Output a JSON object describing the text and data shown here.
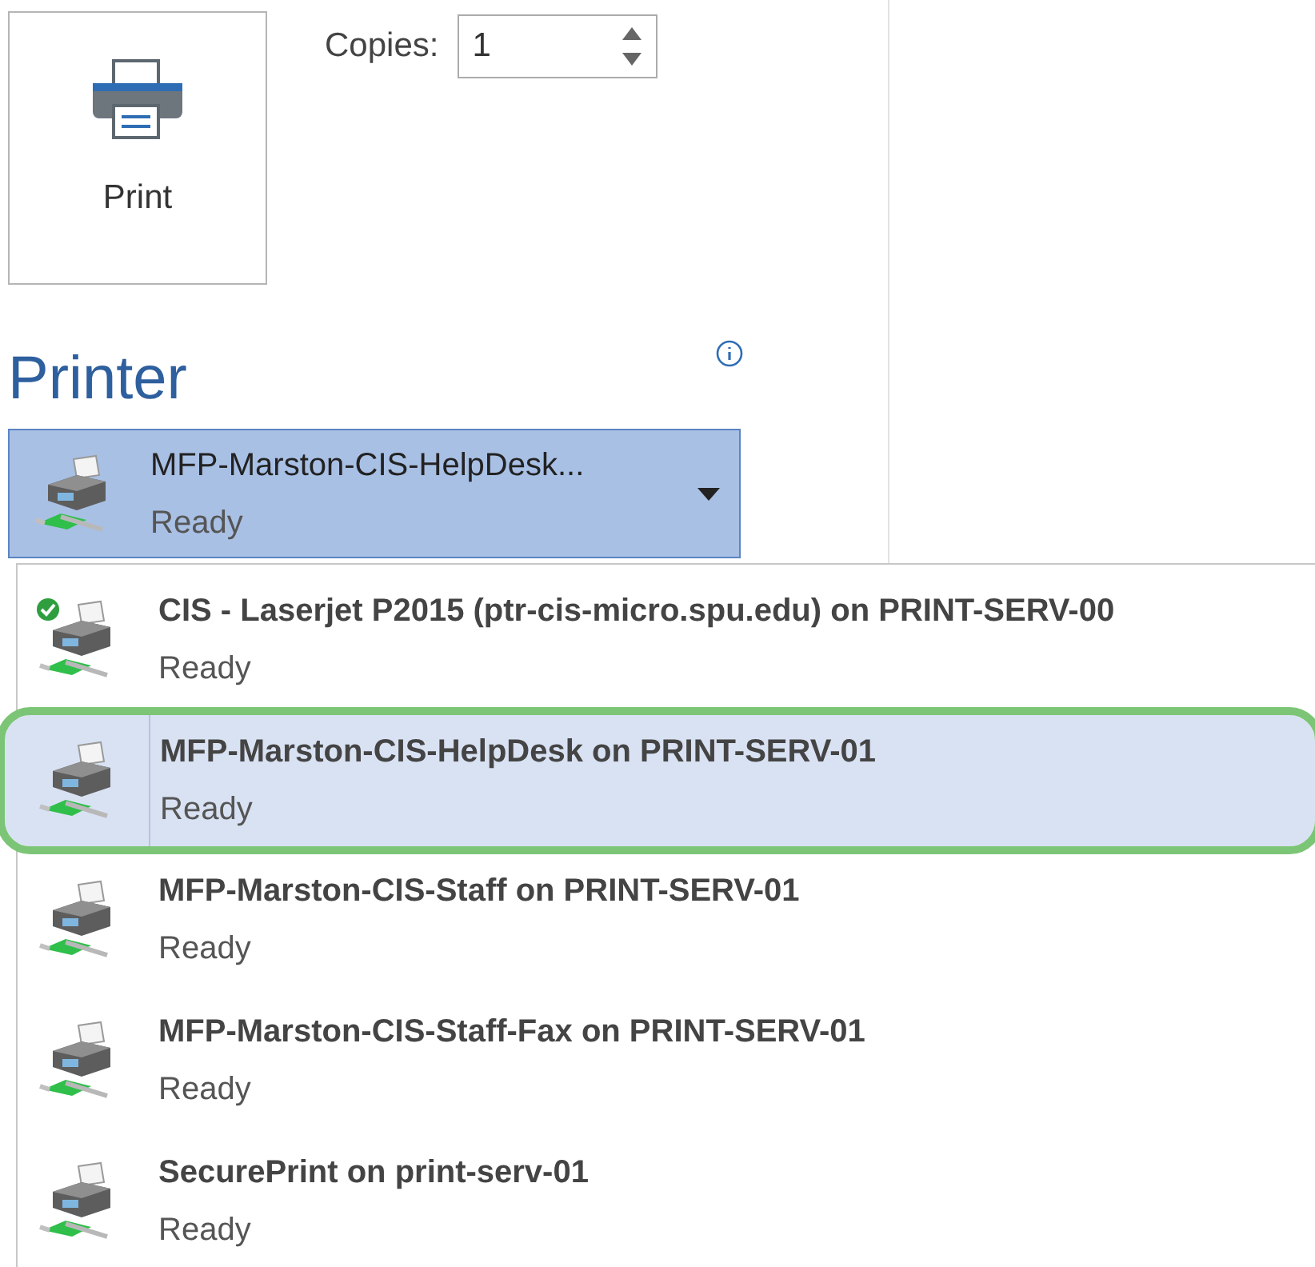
{
  "print_button": {
    "label": "Print"
  },
  "copies": {
    "label": "Copies:",
    "value": "1"
  },
  "printer_section": {
    "title": "Printer"
  },
  "printer_dropdown": {
    "name": "MFP-Marston-CIS-HelpDesk...",
    "status": "Ready",
    "expanded": true
  },
  "printers": [
    {
      "name": "CIS - Laserjet P2015 (ptr-cis-micro.spu.edu) on PRINT-SERV-00",
      "status": "Ready",
      "default": true,
      "selected": false
    },
    {
      "name": "MFP-Marston-CIS-HelpDesk on PRINT-SERV-01",
      "status": "Ready",
      "default": false,
      "selected": true
    },
    {
      "name": "MFP-Marston-CIS-Staff on PRINT-SERV-01",
      "status": "Ready",
      "default": false,
      "selected": false
    },
    {
      "name": "MFP-Marston-CIS-Staff-Fax on PRINT-SERV-01",
      "status": "Ready",
      "default": false,
      "selected": false
    },
    {
      "name": "SecurePrint on print-serv-01",
      "status": "Ready",
      "default": false,
      "selected": false
    }
  ]
}
